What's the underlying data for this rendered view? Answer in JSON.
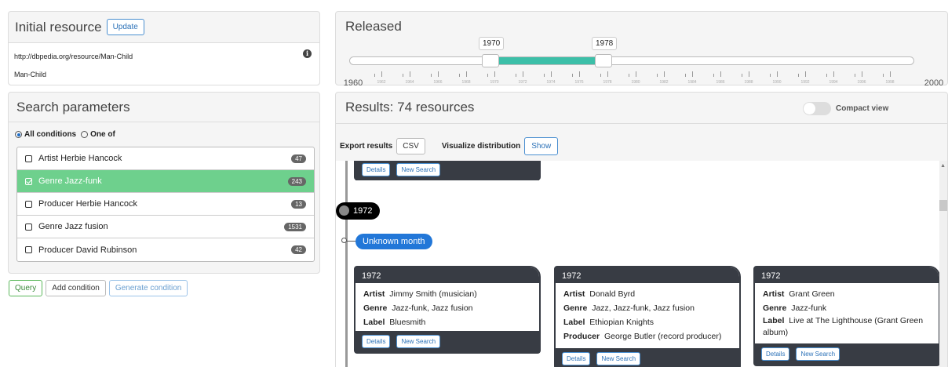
{
  "initial_resource": {
    "title": "Initial resource",
    "update_label": "Update",
    "uri": "http://dbpedia.org/resource/Man-Child",
    "label": "Man-Child",
    "info_icon": "i"
  },
  "search": {
    "title": "Search parameters",
    "all_conditions": "All conditions",
    "one_of": "One of",
    "conditions": [
      {
        "label": "Artist Herbie Hancock",
        "count": "47",
        "checked": false
      },
      {
        "label": "Genre Jazz-funk",
        "count": "243",
        "checked": true
      },
      {
        "label": "Producer Herbie Hancock",
        "count": "13",
        "checked": false
      },
      {
        "label": "Genre Jazz fusion",
        "count": "1531",
        "checked": false
      },
      {
        "label": "Producer David Rubinson",
        "count": "42",
        "checked": false
      }
    ],
    "query_label": "Query",
    "add_condition_label": "Add condition",
    "generate_condition_label": "Generate condition"
  },
  "released": {
    "title": "Released",
    "min_label": "1960",
    "max_label": "2000",
    "low_value": "1970",
    "high_value": "1978",
    "tick_labels": [
      "1962",
      "1964",
      "1966",
      "1968",
      "1970",
      "1972",
      "1974",
      "1976",
      "1978",
      "1980",
      "1982",
      "1984",
      "1986",
      "1988",
      "1990",
      "1992",
      "1994",
      "1996",
      "1998"
    ],
    "range": {
      "min": 1960,
      "max": 2000,
      "low": 1970,
      "high": 1978
    }
  },
  "results": {
    "title": "Results: 74 resources",
    "compact_view_label": "Compact view",
    "export_label": "Export results",
    "csv_label": "CSV",
    "visualize_label": "Visualize distribution",
    "show_label": "Show",
    "year": "1972",
    "month": "Unknown month",
    "details_label": "Details",
    "new_search_label": "New Search",
    "cards": [
      {
        "year": "1972",
        "fields": [
          {
            "key": "Artist",
            "value": "Jimmy Smith (musician)"
          },
          {
            "key": "Genre",
            "value": "Jazz-funk, Jazz fusion"
          },
          {
            "key": "Label",
            "value": "Bluesmith"
          }
        ]
      },
      {
        "year": "1972",
        "fields": [
          {
            "key": "Artist",
            "value": "Donald Byrd"
          },
          {
            "key": "Genre",
            "value": "Jazz, Jazz-funk, Jazz fusion"
          },
          {
            "key": "Label",
            "value": "Ethiopian Knights"
          },
          {
            "key": "Producer",
            "value": "George Butler (record producer)"
          }
        ]
      },
      {
        "year": "1972",
        "fields": [
          {
            "key": "Artist",
            "value": "Grant Green"
          },
          {
            "key": "Genre",
            "value": "Jazz-funk"
          },
          {
            "key": "Label",
            "value": "Live at The Lighthouse (Grant Green album)"
          }
        ]
      }
    ]
  },
  "colors": {
    "active_condition": "#6ed08d",
    "slider_range": "#3cbfa8",
    "month_pill": "#2277d8",
    "card_header": "#383c44"
  }
}
